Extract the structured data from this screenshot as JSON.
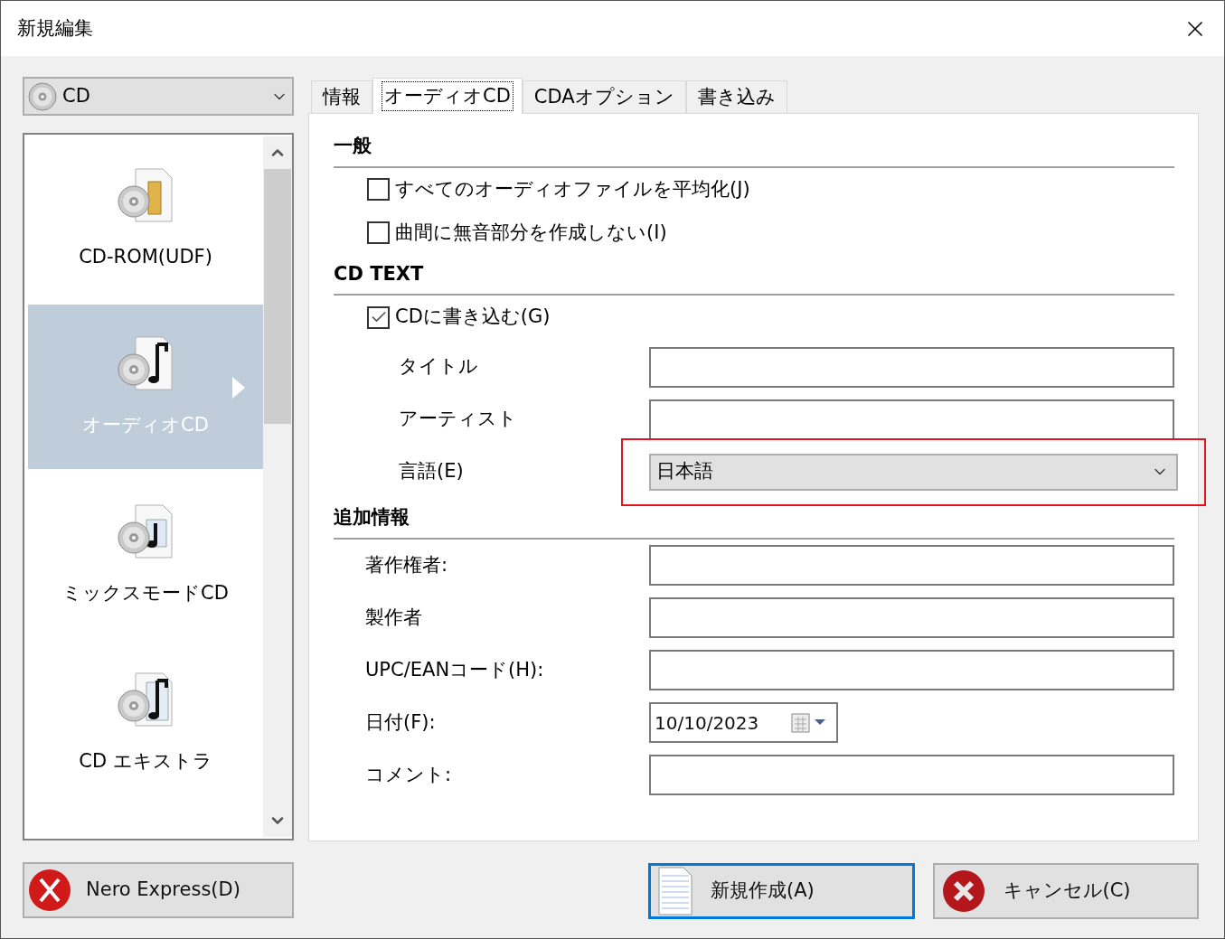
{
  "window": {
    "title": "新規編集"
  },
  "disc_type": {
    "value": "CD"
  },
  "project_list": [
    {
      "label": "CD-ROM(UDF)",
      "kind": "data",
      "selected": false
    },
    {
      "label": "オーディオCD",
      "kind": "audio",
      "selected": true
    },
    {
      "label": "ミックスモードCD",
      "kind": "mixed",
      "selected": false
    },
    {
      "label": "CD エキストラ",
      "kind": "extra",
      "selected": false
    }
  ],
  "tabs": [
    {
      "label": "情報",
      "selected": false
    },
    {
      "label": "オーディオCD",
      "selected": true
    },
    {
      "label": "CDAオプション",
      "selected": false
    },
    {
      "label": "書き込み",
      "selected": false
    }
  ],
  "sections": [
    {
      "heading": "一般",
      "rows": [
        {
          "kind": "checkbox",
          "label": "すべてのオーディオファイルを平均化(J)",
          "checked": false
        },
        {
          "kind": "checkbox",
          "label": "曲間に無音部分を作成しない(I)",
          "checked": false
        }
      ]
    },
    {
      "heading": "CD TEXT",
      "rows": [
        {
          "kind": "checkbox",
          "label": "CDに書き込む(G)",
          "checked": true,
          "children": [
            {
              "kind": "text",
              "label": "タイトル"
            },
            {
              "kind": "text",
              "label": "アーティスト"
            },
            {
              "kind": "select",
              "label": "言語(E)",
              "value": "日本語",
              "highlighted": true
            }
          ]
        }
      ]
    },
    {
      "heading": "追加情報",
      "rows": [
        {
          "kind": "text",
          "label": "著作権者:"
        },
        {
          "kind": "text",
          "label": "製作者"
        },
        {
          "kind": "text",
          "label": "UPC/EANコード(H):"
        },
        {
          "kind": "date",
          "label": "日付(F):",
          "value": "10/10/2023"
        },
        {
          "kind": "text",
          "label": "コメント:"
        }
      ]
    }
  ],
  "buttons": [
    {
      "label": "Nero Express(D)",
      "kind": "nero",
      "default": false
    },
    {
      "label": "新規作成(A)",
      "kind": "new",
      "default": true
    },
    {
      "label": "キャンセル(C)",
      "kind": "cancel",
      "default": false
    }
  ]
}
